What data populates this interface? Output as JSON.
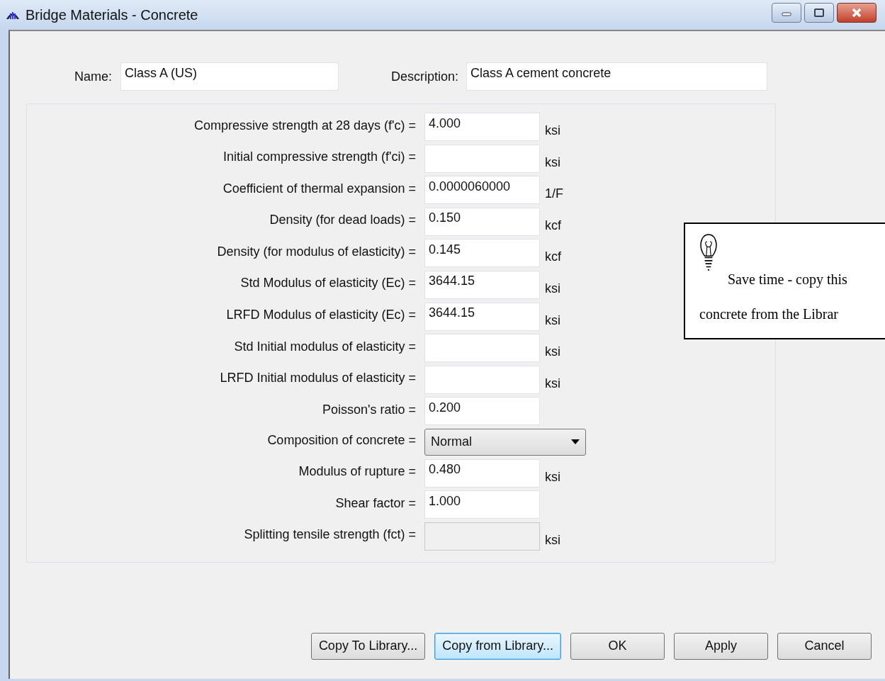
{
  "window": {
    "title": "Bridge Materials - Concrete"
  },
  "name": {
    "label": "Name:",
    "value": "Class A (US)"
  },
  "description": {
    "label": "Description:",
    "value": "Class A cement concrete"
  },
  "properties": [
    {
      "label": "Compressive strength at 28 days (f'c) =",
      "kind": "text",
      "value": "4.000",
      "unit": "ksi",
      "disabled": false
    },
    {
      "label": "Initial compressive strength (f'ci) =",
      "kind": "text",
      "unit": "ksi",
      "disabled": false
    },
    {
      "label": "Coefficient of thermal expansion =",
      "kind": "text",
      "value": "0.0000060000",
      "unit": "1/F",
      "disabled": false
    },
    {
      "label": "Density (for dead loads) =",
      "kind": "text",
      "value": "0.150",
      "unit": "kcf",
      "disabled": false
    },
    {
      "label": "Density (for modulus of elasticity) =",
      "kind": "text",
      "value": "0.145",
      "unit": "kcf",
      "disabled": false
    },
    {
      "label": "Std Modulus of elasticity (Ec) =",
      "kind": "text",
      "value": "3644.15",
      "unit": "ksi",
      "disabled": false
    },
    {
      "label": "LRFD Modulus of elasticity (Ec) =",
      "kind": "text",
      "value": "3644.15",
      "unit": "ksi",
      "disabled": false
    },
    {
      "label": "Std Initial modulus of elasticity =",
      "kind": "text",
      "unit": "ksi",
      "disabled": false
    },
    {
      "label": "LRFD Initial modulus of elasticity =",
      "kind": "text",
      "unit": "ksi",
      "disabled": false
    },
    {
      "label": "Poisson's ratio =",
      "kind": "text",
      "value": "0.200",
      "disabled": false
    },
    {
      "label": "Composition of concrete =",
      "kind": "combo",
      "value": "Normal",
      "disabled": false
    },
    {
      "label": "Modulus of rupture =",
      "kind": "text",
      "value": "0.480",
      "unit": "ksi",
      "disabled": false
    },
    {
      "label": "Shear factor =",
      "kind": "text",
      "value": "1.000",
      "disabled": false
    },
    {
      "label": "Splitting tensile strength (fct) =",
      "kind": "text",
      "unit": "ksi",
      "disabled": true
    }
  ],
  "buttons": [
    {
      "label": "Copy To Library...",
      "focused": false
    },
    {
      "label": "Copy from Library...",
      "focused": true
    },
    {
      "label": "OK",
      "focused": false
    },
    {
      "label": "Apply",
      "focused": false
    },
    {
      "label": "Cancel",
      "focused": false
    }
  ],
  "callout": {
    "lines": [
      "Save time - copy this",
      "concrete from the Librar"
    ]
  }
}
